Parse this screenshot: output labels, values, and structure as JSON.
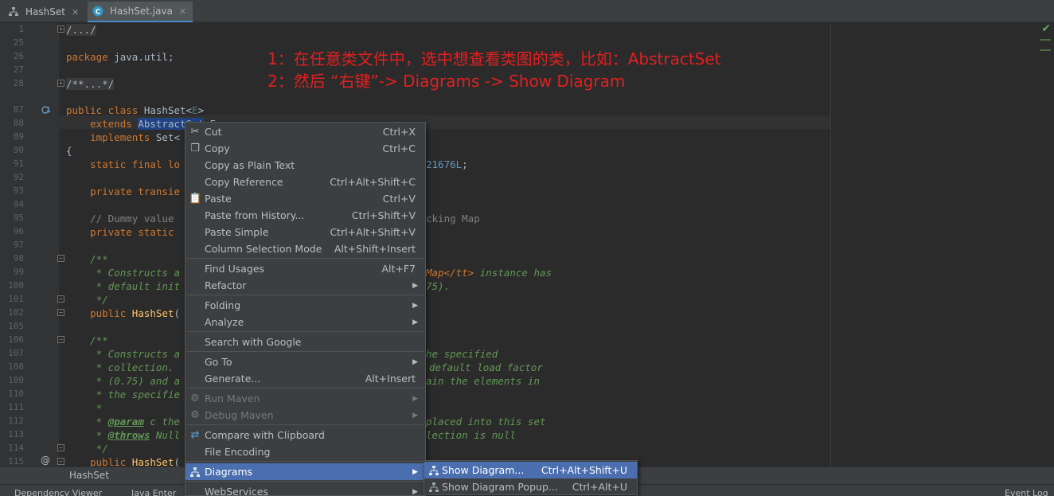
{
  "tabs": [
    {
      "label": "HashSet",
      "icon": "hierarchy-icon",
      "active": false
    },
    {
      "label": "HashSet.java",
      "icon": "java-class-icon",
      "active": true
    }
  ],
  "annotation": {
    "line1": "1：在任意类文件中，选中想查看类图的类，比如：AbstractSet",
    "line2": "2：然后 “右键”-> Diagrams -> Show Diagram"
  },
  "line_numbers": [
    "1",
    "25",
    "26",
    "27",
    "28",
    "87",
    "88",
    "89",
    "90",
    "91",
    "92",
    "93",
    "94",
    "95",
    "96",
    "97",
    "98",
    "99",
    "100",
    "101",
    "102",
    "105",
    "106",
    "107",
    "108",
    "109",
    "110",
    "111",
    "112",
    "113",
    "114",
    "115"
  ],
  "code": {
    "l1": "/.../",
    "l26_kw": "package",
    "l26_rest": " java.util;",
    "l28": "/**...*/",
    "l87_kw": "public class",
    "l87_rest": " HashSet<",
    "l87_e": "E",
    "l87_end": ">",
    "l88_kw": "extends",
    "l88_sel": "AbstractSet",
    "l88_rest": "<E>",
    "l89_kw": "implements",
    "l89_rest": " Set<",
    "l90": "{",
    "l91_kw": "static final lo",
    "l91_num": "21676L",
    "l91_end": ";",
    "l93_kw": "private transie",
    "l95_cm": "// Dummy value",
    "l95_cm2": "cking Map",
    "l96_kw": "private static",
    "l98_cm": "/**",
    "l99_cm": " * Constructs a",
    "l99_tg": "Map</tt>",
    "l99_cm2": " instance has",
    "l100_cm": " * default init",
    "l100_cm2": "75).",
    "l101_cm": " */",
    "l102_kw": "public",
    "l102_fn": "HashSet",
    "l102_rest": "(",
    "l106_cm": "/**",
    "l107_cm": " * Constructs a",
    "l107_cm2": "he specified",
    "l108_cm": " * collection.",
    "l108_cm2": "default load factor",
    "l109_cm": " * (0.75) and a",
    "l109_cm2": "ain the elements in",
    "l110_cm": " * the specifie",
    "l111_cm": " *",
    "l112_tag": "@param",
    "l112_cm": " c the",
    "l112_cm2": "placed into this set",
    "l113_tag": "@throws",
    "l113_cm": " Null",
    "l113_cm2": "lection is null",
    "l114_cm": " */",
    "l115_kw": "public",
    "l115_fn": "HashSet",
    "l115_rest": "("
  },
  "breadcrumb": "HashSet",
  "bottom_bar": {
    "dependency_viewer": "Dependency Viewer",
    "java_enterprise": "Java Enter",
    "event_log": "Event Log"
  },
  "context_menu": {
    "items": [
      {
        "label": "Cut",
        "shortcut": "Ctrl+X",
        "icon": "scissors-icon"
      },
      {
        "label": "Copy",
        "shortcut": "Ctrl+C",
        "icon": "copy-icon"
      },
      {
        "label": "Copy as Plain Text",
        "shortcut": ""
      },
      {
        "label": "Copy Reference",
        "shortcut": "Ctrl+Alt+Shift+C"
      },
      {
        "label": "Paste",
        "shortcut": "Ctrl+V",
        "icon": "paste-icon"
      },
      {
        "label": "Paste from History...",
        "shortcut": "Ctrl+Shift+V"
      },
      {
        "label": "Paste Simple",
        "shortcut": "Ctrl+Alt+Shift+V"
      },
      {
        "label": "Column Selection Mode",
        "shortcut": "Alt+Shift+Insert"
      },
      {
        "label": "Find Usages",
        "shortcut": "Alt+F7"
      },
      {
        "label": "Refactor",
        "shortcut": ""
      },
      {
        "label": "Folding",
        "shortcut": ""
      },
      {
        "label": "Analyze",
        "shortcut": ""
      },
      {
        "label": "Search with Google",
        "shortcut": ""
      },
      {
        "label": "Go To",
        "shortcut": ""
      },
      {
        "label": "Generate...",
        "shortcut": "Alt+Insert"
      },
      {
        "label": "Run Maven",
        "shortcut": "",
        "icon": "maven-gear-icon",
        "disabled": true
      },
      {
        "label": "Debug Maven",
        "shortcut": "",
        "icon": "maven-debug-icon",
        "disabled": true
      },
      {
        "label": "Compare with Clipboard",
        "shortcut": "",
        "icon": "compare-icon"
      },
      {
        "label": "File Encoding",
        "shortcut": ""
      },
      {
        "label": "Diagrams",
        "shortcut": "",
        "icon": "diagram-icon",
        "highlighted": true
      },
      {
        "label": "WebServices",
        "shortcut": ""
      }
    ]
  },
  "diagrams_submenu": {
    "items": [
      {
        "label": "Show Diagram...",
        "shortcut": "Ctrl+Alt+Shift+U",
        "icon": "diagram-icon",
        "highlighted": true
      },
      {
        "label": "Show Diagram Popup...",
        "shortcut": "Ctrl+Alt+U",
        "icon": "diagram-icon"
      }
    ]
  },
  "colors": {
    "editor_bg": "#2b2b2b",
    "menu_bg": "#3c3f41",
    "menu_highlight": "#4b6eaf",
    "annotation_red": "#e02020",
    "keyword": "#cc7832",
    "comment": "#629755",
    "selection": "#214283"
  }
}
